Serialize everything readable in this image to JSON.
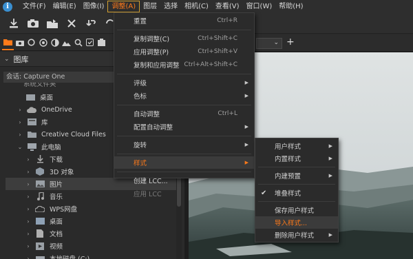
{
  "menubar": {
    "app_icon": "i",
    "items": [
      "文件(F)",
      "编辑(E)",
      "图像(I)",
      "调整(A)",
      "图层",
      "选择",
      "相机(C)",
      "查看(V)",
      "窗口(W)",
      "帮助(H)"
    ],
    "active_index": 3
  },
  "toolbar": {
    "icons": [
      "import-icon",
      "camera-icon",
      "export-icon",
      "delete-icon",
      "undo-icon",
      "redo-icon"
    ]
  },
  "tabstrip": {
    "icons": [
      "library-folder-icon",
      "capture-icon",
      "lens-icon",
      "color-icon",
      "exposure-icon",
      "details-icon",
      "adjustments-icon",
      "metadata-icon",
      "output-icon"
    ]
  },
  "library": {
    "title": "图库",
    "session": "会话: Capture One",
    "cut_label": "系统文件夹",
    "tree": [
      {
        "label": "桌面",
        "icon": "folder-icon",
        "arrow": "",
        "indent": 1
      },
      {
        "label": "OneDrive",
        "icon": "cloud-icon",
        "arrow": "›",
        "indent": 2
      },
      {
        "label": "库",
        "icon": "library-icon",
        "arrow": "›",
        "indent": 2
      },
      {
        "label": "Creative Cloud Files",
        "icon": "cc-folder-icon",
        "arrow": "›",
        "indent": 2
      },
      {
        "label": "此电脑",
        "icon": "computer-icon",
        "arrow": "⌄",
        "indent": 2
      },
      {
        "label": "下载",
        "icon": "download-icon",
        "arrow": "›",
        "indent": 3
      },
      {
        "label": "3D 对象",
        "icon": "3d-object-icon",
        "arrow": "›",
        "indent": 3
      },
      {
        "label": "图片",
        "icon": "pictures-icon",
        "arrow": "›",
        "indent": 3,
        "selected": true
      },
      {
        "label": "音乐",
        "icon": "music-icon",
        "arrow": "›",
        "indent": 3
      },
      {
        "label": "WPS网盘",
        "icon": "wps-cloud-icon",
        "arrow": "›",
        "indent": 3
      },
      {
        "label": "桌面",
        "icon": "desktop-icon",
        "arrow": "›",
        "indent": 3
      },
      {
        "label": "文档",
        "icon": "documents-icon",
        "arrow": "›",
        "indent": 3
      },
      {
        "label": "视频",
        "icon": "video-icon",
        "arrow": "›",
        "indent": 3
      },
      {
        "label": "本地磁盘 (C:)",
        "icon": "drive-icon",
        "arrow": "›",
        "indent": 3
      }
    ]
  },
  "adjust_menu": {
    "items": [
      {
        "label": "重置",
        "shortcut": "Ctrl+R"
      },
      {
        "sep": true
      },
      {
        "label": "复制调整(C)",
        "shortcut": "Ctrl+Shift+C"
      },
      {
        "label": "应用调整(P)",
        "shortcut": "Ctrl+Shift+V"
      },
      {
        "label": "复制和应用调整",
        "shortcut": "Ctrl+Alt+Shift+C"
      },
      {
        "sep": true
      },
      {
        "label": "评级",
        "submenu": true
      },
      {
        "label": "色标",
        "submenu": true
      },
      {
        "sep": true
      },
      {
        "label": "自动调整",
        "shortcut": "Ctrl+L"
      },
      {
        "label": "配置自动调整",
        "submenu": true
      },
      {
        "sep": true
      },
      {
        "label": "旋转",
        "submenu": true
      },
      {
        "sep": true
      },
      {
        "label": "样式",
        "submenu": true,
        "highlight": true
      },
      {
        "sep": true
      },
      {
        "label": "创建 LCC..."
      },
      {
        "label": "应用 LCC",
        "disabled": true
      }
    ]
  },
  "styles_menu": {
    "items": [
      {
        "label": "用户样式",
        "submenu": true
      },
      {
        "label": "内置样式",
        "submenu": true
      },
      {
        "sep": true
      },
      {
        "label": "内建预置",
        "submenu": true
      },
      {
        "sep": true
      },
      {
        "label": "堆叠样式",
        "checked": true
      },
      {
        "sep": true
      },
      {
        "label": "保存用户样式"
      },
      {
        "label": "导入样式...",
        "highlight": true
      },
      {
        "label": "删除用户样式",
        "submenu": true
      }
    ]
  },
  "viewer": {
    "select_value": "",
    "plus_label": "+"
  },
  "colors": {
    "accent": "#ff7a1a",
    "menu_bg": "#2b2b2b",
    "panel_bg": "#2a2a2a"
  }
}
